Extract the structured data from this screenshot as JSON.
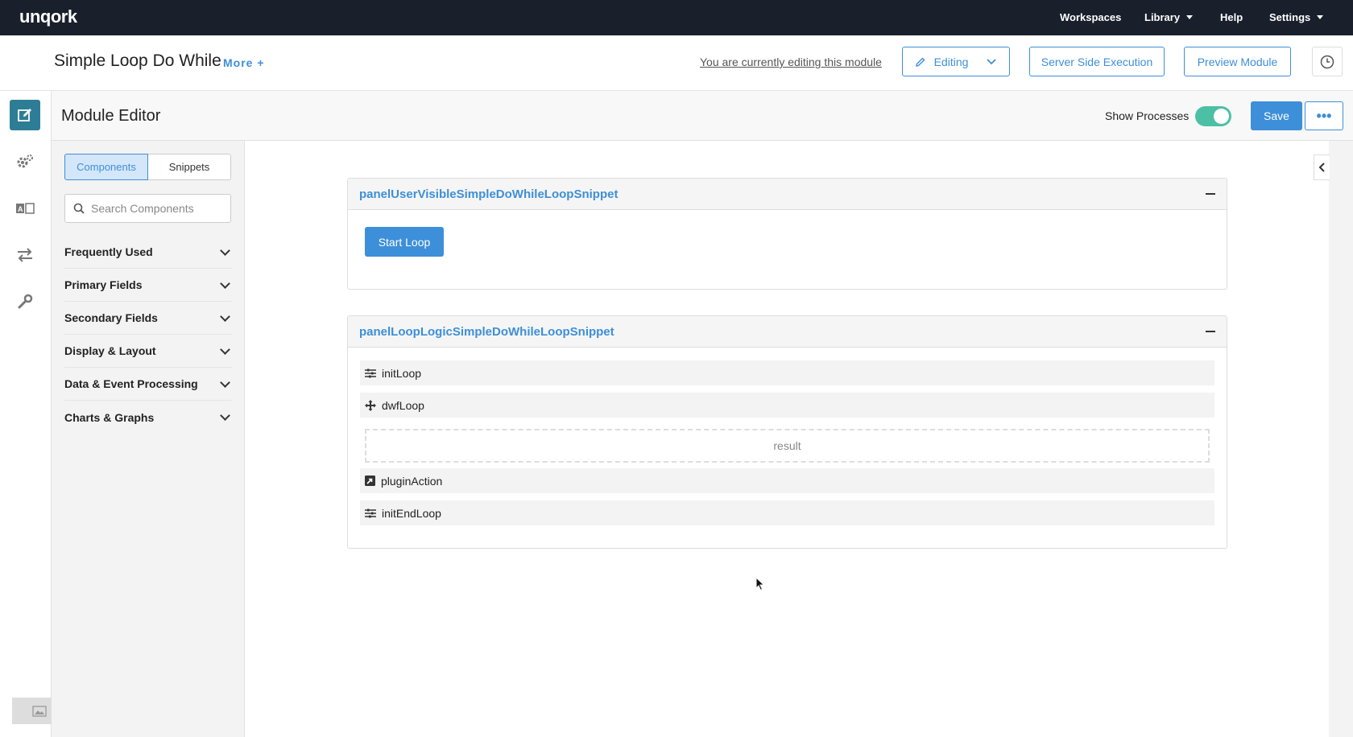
{
  "app": {
    "logo": "unqork",
    "nav": {
      "workspaces": "Workspaces",
      "library": "Library",
      "help": "Help",
      "settings": "Settings"
    }
  },
  "module_bar": {
    "title": "Simple Loop Do While",
    "more": "More +",
    "editing_note": "You are currently editing this module",
    "editing_label": "Editing",
    "server_side_label": "Server Side Execution",
    "preview_label": "Preview Module"
  },
  "editor_bar": {
    "title": "Module Editor",
    "show_processes_label": "Show Processes",
    "show_processes_on": true,
    "save_label": "Save",
    "more_label": "•••"
  },
  "side_panel": {
    "tabs": [
      "Components",
      "Snippets"
    ],
    "active_tab": "Components",
    "search_placeholder": "Search Components",
    "categories": [
      "Frequently Used",
      "Primary Fields",
      "Secondary Fields",
      "Display & Layout",
      "Data & Event Processing",
      "Charts & Graphs"
    ]
  },
  "canvas": {
    "panels": [
      {
        "title": "panelUserVisibleSimpleDoWhileLoopSnippet",
        "button_label": "Start Loop"
      },
      {
        "title": "panelLoopLogicSimpleDoWhileLoopSnippet",
        "components": [
          {
            "label": "initLoop",
            "icon": "sliders-icon"
          },
          {
            "label": "dwfLoop",
            "icon": "move-icon"
          },
          {
            "label": "result",
            "type": "dropzone"
          },
          {
            "label": "pluginAction",
            "icon": "plugin-icon"
          },
          {
            "label": "initEndLoop",
            "icon": "sliders-icon"
          }
        ]
      }
    ]
  },
  "colors": {
    "topnav": "#1a1f2c",
    "accent": "#3d8fd9",
    "active_rail": "#2e7d96",
    "toggle": "#4cc0a5"
  }
}
